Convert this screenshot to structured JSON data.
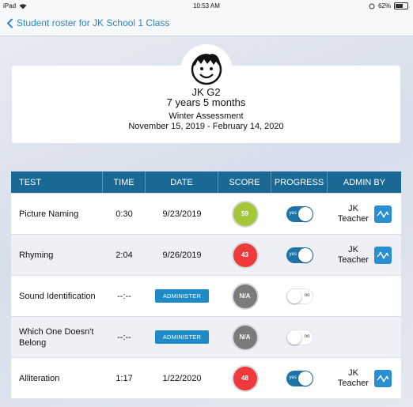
{
  "status": {
    "device": "iPad",
    "time": "10:53 AM",
    "battery": "62%"
  },
  "nav": {
    "back_label": "Student roster for JK School 1 Class"
  },
  "student": {
    "name": "JK G2",
    "age": "7 years 5 months",
    "assessment": "Winter Assessment",
    "date_range": "November 15, 2019 - February 14, 2020"
  },
  "table": {
    "headers": {
      "test": "TEST",
      "time": "TIME",
      "date": "DATE",
      "score": "SCORE",
      "progress": "PROGRESS",
      "admin": "ADMIN BY"
    },
    "rows": [
      {
        "test": "Picture Naming",
        "time": "0:30",
        "date": "9/23/2019",
        "score": "59",
        "score_color": "#a4c73a",
        "progress": "yes",
        "admin": "JK Teacher"
      },
      {
        "test": "Rhyming",
        "time": "2:04",
        "date": "9/26/2019",
        "score": "43",
        "score_color": "#ee3a3a",
        "progress": "yes",
        "admin": "JK Teacher"
      },
      {
        "test": "Sound Identification",
        "time": "--:--",
        "date_button": "ADMINISTER",
        "score": "N/A",
        "score_color": "#7b7b7b",
        "progress": "no",
        "admin": ""
      },
      {
        "test": "Which One Doesn't Belong",
        "time": "--:--",
        "date_button": "ADMINISTER",
        "score": "N/A",
        "score_color": "#7b7b7b",
        "progress": "no",
        "admin": ""
      },
      {
        "test": "Alliteration",
        "time": "1:17",
        "date": "1/22/2020",
        "score": "48",
        "score_color": "#ee3a3a",
        "progress": "yes",
        "admin": "JK Teacher"
      }
    ]
  },
  "colors": {
    "header": "#1a6994",
    "accent": "#2a86c9",
    "toggle_on": "#1e73a8"
  }
}
